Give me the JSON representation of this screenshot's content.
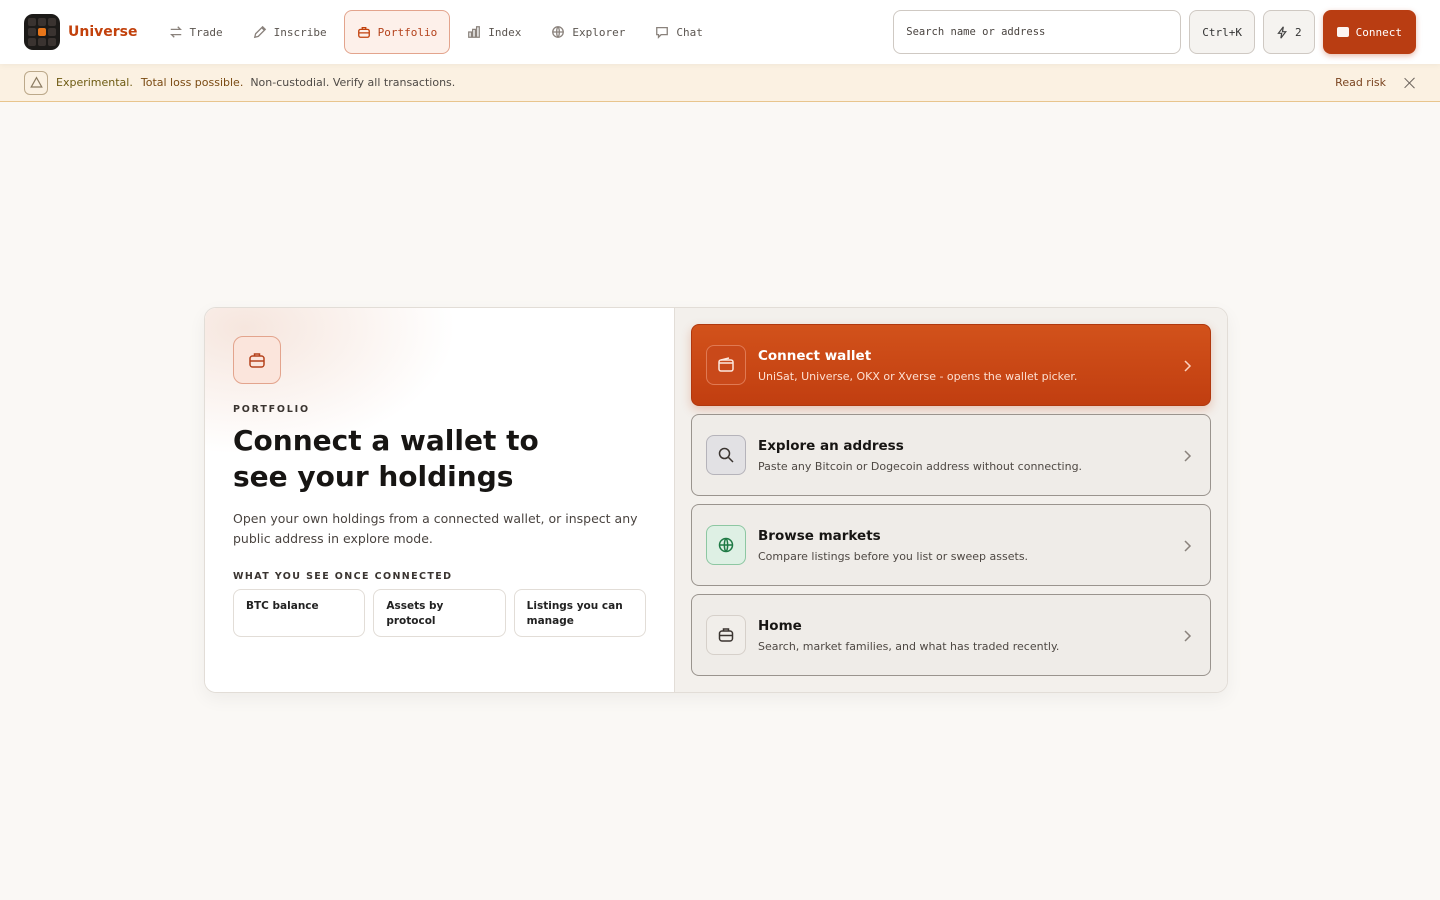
{
  "brand": {
    "name": "Universe"
  },
  "nav": [
    {
      "label": "Trade",
      "icon": "swap-icon"
    },
    {
      "label": "Inscribe",
      "icon": "pencil-icon"
    },
    {
      "label": "Portfolio",
      "icon": "briefcase-icon",
      "active": true
    },
    {
      "label": "Index",
      "icon": "bar-chart-icon"
    },
    {
      "label": "Explorer",
      "icon": "globe-icon"
    },
    {
      "label": "Chat",
      "icon": "chat-icon"
    }
  ],
  "search": {
    "placeholder": "Search name or address"
  },
  "shortcut": {
    "label": "Ctrl+K"
  },
  "activity": {
    "count": "2",
    "icon": "lightning-icon"
  },
  "connect": {
    "label": "Connect",
    "icon": "wallet-icon"
  },
  "banner": {
    "experimental": "Experimental.",
    "loss": "Total loss possible.",
    "rest": "Non-custodial. Verify all transactions.",
    "read_risk": "Read risk",
    "icon": "warning-icon"
  },
  "portfolio": {
    "eyebrow": "PORTFOLIO",
    "headline": "Connect a wallet to see your holdings",
    "description": "Open your own holdings from a connected wallet, or inspect any public address in explore mode.",
    "section_label": "WHAT YOU SEE ONCE CONNECTED",
    "features": [
      "BTC balance",
      "Assets by protocol",
      "Listings you can manage"
    ]
  },
  "options": [
    {
      "title": "Connect wallet",
      "subtitle": "UniSat, Universe, OKX or Xverse - opens the wallet picker.",
      "icon": "wallet-icon"
    },
    {
      "title": "Explore an address",
      "subtitle": "Paste any Bitcoin or Dogecoin address without connecting.",
      "icon": "search-icon"
    },
    {
      "title": "Browse markets",
      "subtitle": "Compare listings before you list or sweep assets.",
      "icon": "globe-icon"
    },
    {
      "title": "Home",
      "subtitle": "Search, market families, and what has traded recently.",
      "icon": "briefcase-icon"
    }
  ],
  "colors": {
    "accent": "#b93d12",
    "banner_bg": "#fbf1e2",
    "page_bg": "#faf8f5"
  }
}
